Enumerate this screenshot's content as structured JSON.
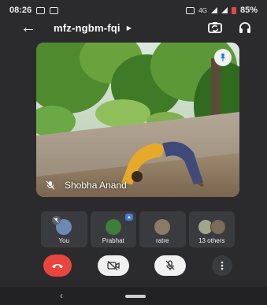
{
  "status_bar": {
    "time": "08:26",
    "network": "4G",
    "battery": "85%"
  },
  "header": {
    "meeting_code": "mfz-ngbm-fqi"
  },
  "main_video": {
    "participant_name": "Shobha Anand",
    "muted": true
  },
  "participants": [
    {
      "label": "You",
      "muted": true
    },
    {
      "label": "Prabhat",
      "pinned": true
    },
    {
      "label": "ratre"
    },
    {
      "label": "13 others"
    }
  ],
  "controls": {
    "end_call": "end-call",
    "camera": "camera-off",
    "mic": "mic-off",
    "more": "more-options"
  },
  "colors": {
    "background": "#2b2b2d",
    "tile": "#3a3b3e",
    "end_call": "#e8453c"
  }
}
